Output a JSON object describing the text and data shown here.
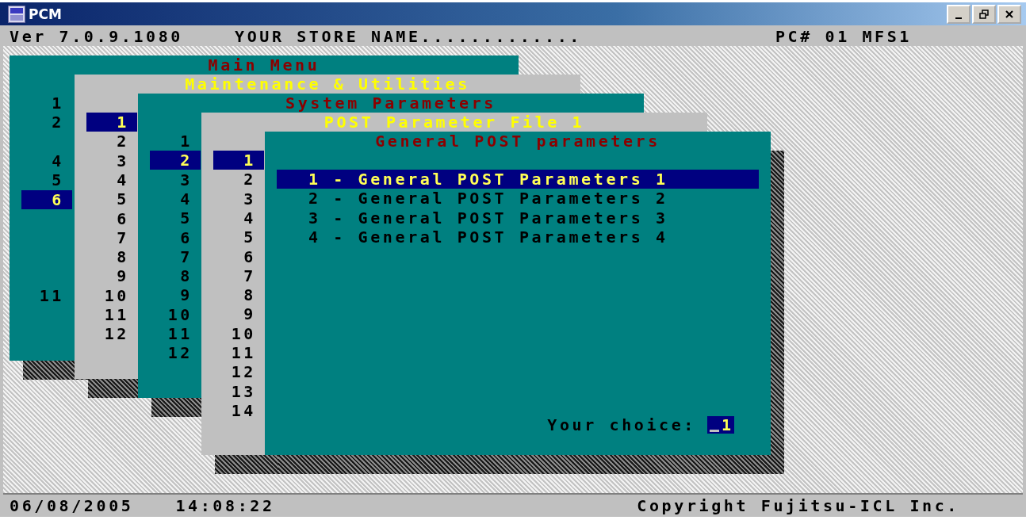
{
  "window": {
    "title": "PCM"
  },
  "header": {
    "version": "Ver 7.0.9.1080",
    "store": "YOUR STORE NAME.............",
    "station": "PC# 01 MFS1"
  },
  "menus": [
    {
      "title": "Main Menu",
      "items": [
        {
          "label": "1",
          "selected": false
        },
        {
          "label": "2",
          "selected": false
        },
        {
          "label": "4",
          "selected": false
        },
        {
          "label": "5",
          "selected": false
        },
        {
          "label": "6",
          "selected": true
        },
        {
          "label": "11",
          "selected": false
        }
      ]
    },
    {
      "title": "Maintenance & Utilities",
      "items": [
        {
          "label": "1",
          "selected": true
        },
        {
          "label": "2",
          "selected": false
        },
        {
          "label": "3",
          "selected": false
        },
        {
          "label": "4",
          "selected": false
        },
        {
          "label": "5",
          "selected": false
        },
        {
          "label": "6",
          "selected": false
        },
        {
          "label": "7",
          "selected": false
        },
        {
          "label": "8",
          "selected": false
        },
        {
          "label": "9",
          "selected": false
        },
        {
          "label": "10",
          "selected": false
        },
        {
          "label": "11",
          "selected": false
        },
        {
          "label": "12",
          "selected": false
        }
      ]
    },
    {
      "title": "System Parameters",
      "items": [
        {
          "label": "1",
          "selected": false
        },
        {
          "label": "2",
          "selected": true
        },
        {
          "label": "3",
          "selected": false
        },
        {
          "label": "4",
          "selected": false
        },
        {
          "label": "5",
          "selected": false
        },
        {
          "label": "6",
          "selected": false
        },
        {
          "label": "7",
          "selected": false
        },
        {
          "label": "8",
          "selected": false
        },
        {
          "label": "9",
          "selected": false
        },
        {
          "label": "10",
          "selected": false
        },
        {
          "label": "11",
          "selected": false
        },
        {
          "label": "12",
          "selected": false
        }
      ]
    },
    {
      "title": "POST Parameter File 1",
      "items": [
        {
          "label": "1",
          "selected": true
        },
        {
          "label": "2",
          "selected": false
        },
        {
          "label": "3",
          "selected": false
        },
        {
          "label": "4",
          "selected": false
        },
        {
          "label": "5",
          "selected": false
        },
        {
          "label": "6",
          "selected": false
        },
        {
          "label": "7",
          "selected": false
        },
        {
          "label": "8",
          "selected": false
        },
        {
          "label": "9",
          "selected": false
        },
        {
          "label": "10",
          "selected": false
        },
        {
          "label": "11",
          "selected": false
        },
        {
          "label": "12",
          "selected": false
        },
        {
          "label": "13",
          "selected": false
        },
        {
          "label": "14",
          "selected": false
        }
      ]
    },
    {
      "title": "General POST parameters",
      "items": [
        {
          "label": "1 - General POST Parameters 1",
          "selected": true
        },
        {
          "label": "2 - General POST Parameters 2",
          "selected": false
        },
        {
          "label": "3 - General POST Parameters 3",
          "selected": false
        },
        {
          "label": "4 - General POST Parameters 4",
          "selected": false
        }
      ],
      "prompt": "Your choice:",
      "choice": "1"
    }
  ],
  "status_bar": {
    "date": "06/08/2005",
    "time": "14:08:22",
    "copyright": "Copyright Fujitsu-ICL Inc."
  }
}
